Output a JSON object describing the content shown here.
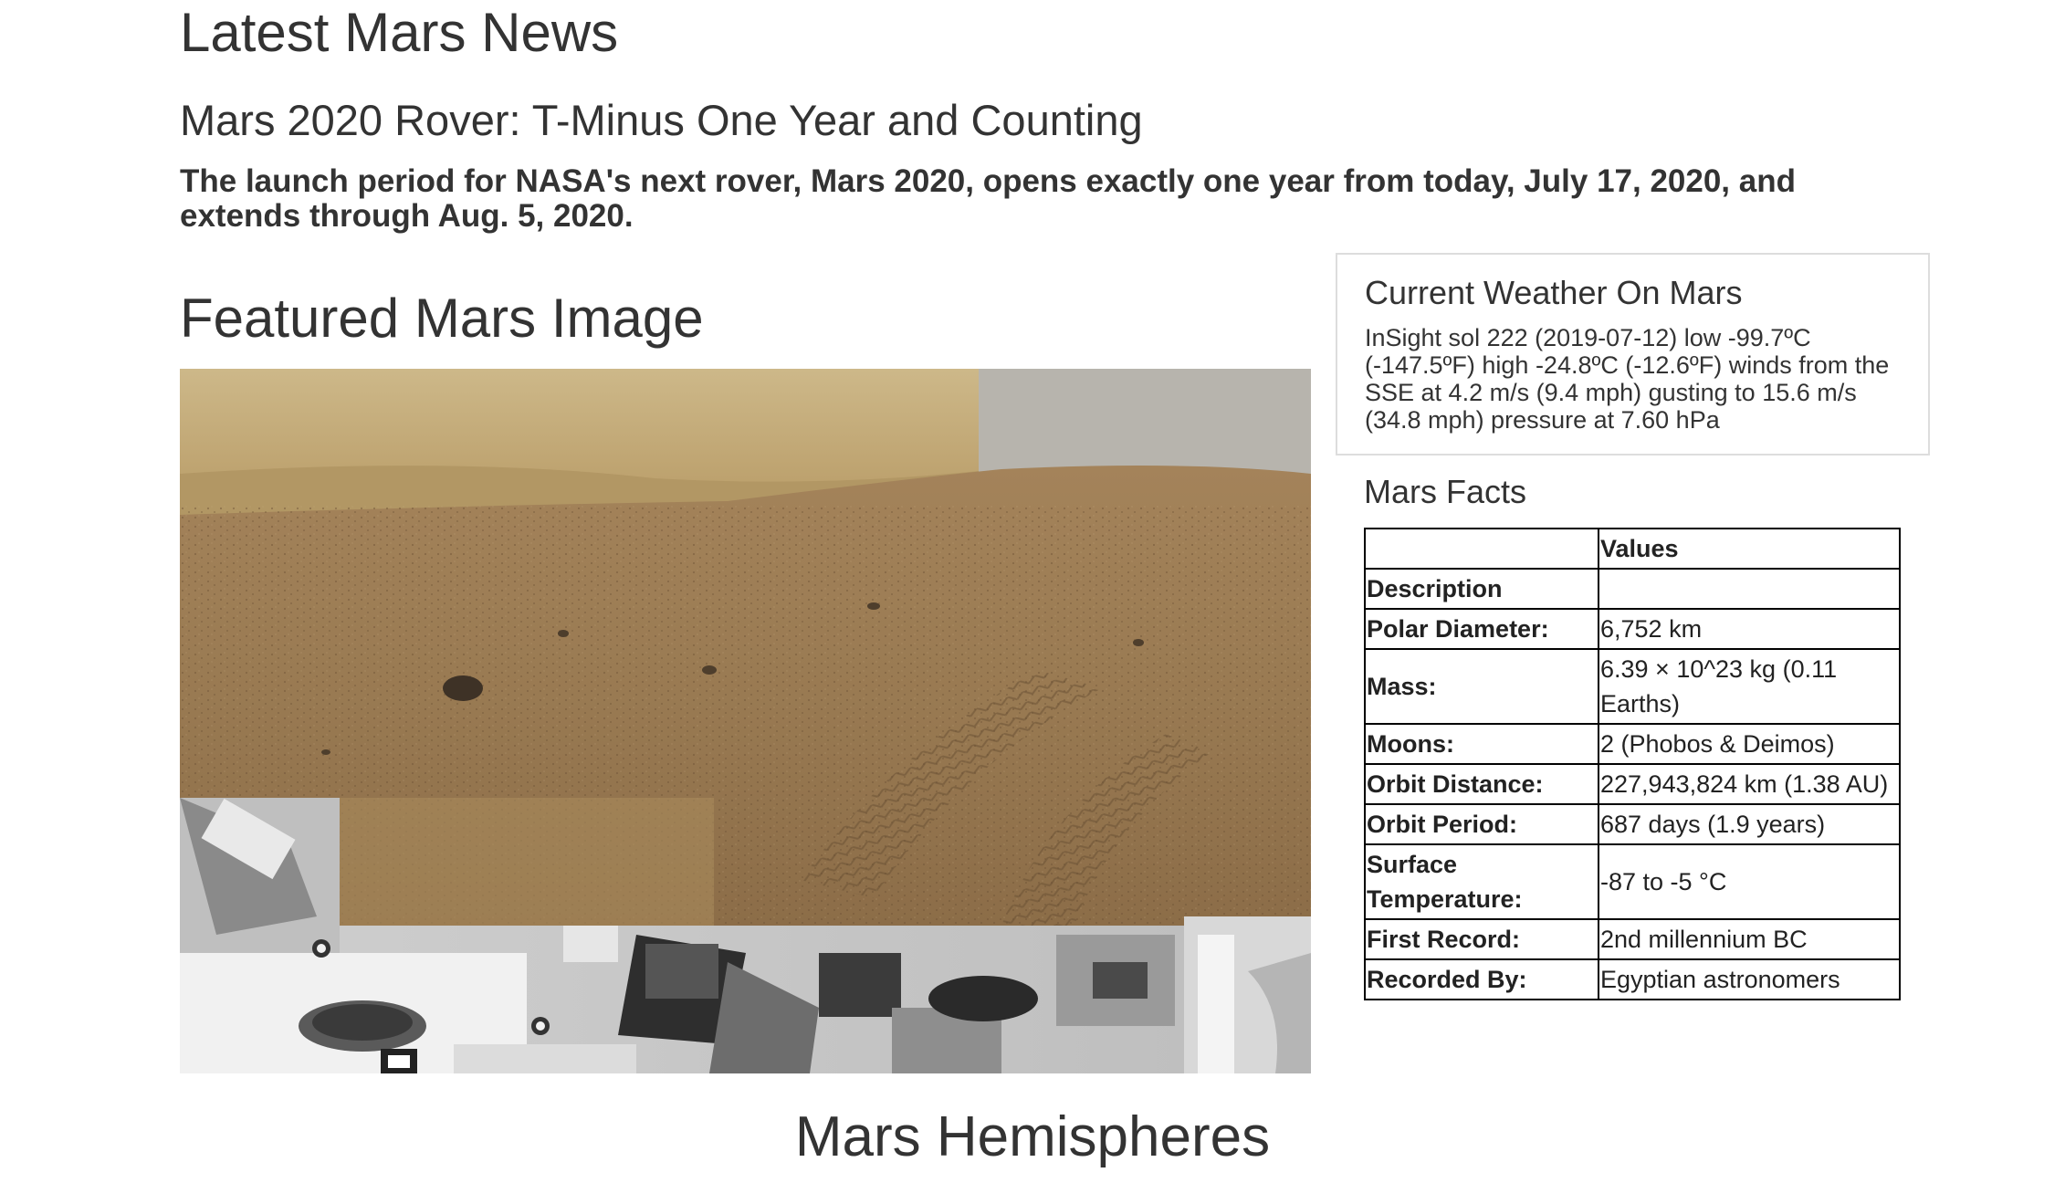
{
  "news": {
    "section_heading": "Latest Mars News",
    "title": "Mars 2020 Rover: T-Minus One Year and Counting",
    "paragraph": "The launch period for NASA's next rover, Mars 2020, opens exactly one year from today, July 17, 2020, and extends through Aug. 5, 2020."
  },
  "featured": {
    "section_heading": "Featured Mars Image"
  },
  "weather": {
    "title": "Current Weather On Mars",
    "text": "InSight sol 222 (2019-07-12) low -99.7ºC (-147.5ºF) high -24.8ºC (-12.6ºF) winds from the SSE at 4.2 m/s (9.4 mph) gusting to 15.6 m/s (34.8 mph) pressure at 7.60 hPa"
  },
  "facts": {
    "heading": "Mars Facts",
    "columns": [
      "",
      "Values"
    ],
    "rows": [
      {
        "label": "Description",
        "value": ""
      },
      {
        "label": "Polar Diameter:",
        "value": "6,752 km"
      },
      {
        "label": "Mass:",
        "value": "6.39 × 10^23 kg (0.11 Earths)"
      },
      {
        "label": "Moons:",
        "value": "2 (Phobos & Deimos)"
      },
      {
        "label": "Orbit Distance:",
        "value": "227,943,824 km (1.38 AU)"
      },
      {
        "label": "Orbit Period:",
        "value": "687 days (1.9 years)"
      },
      {
        "label": "Surface Temperature:",
        "value": "-87 to -5 °C"
      },
      {
        "label": "First Record:",
        "value": "2nd millennium BC"
      },
      {
        "label": "Recorded By:",
        "value": "Egyptian astronomers"
      }
    ]
  },
  "hemispheres": {
    "section_heading": "Mars Hemispheres"
  }
}
